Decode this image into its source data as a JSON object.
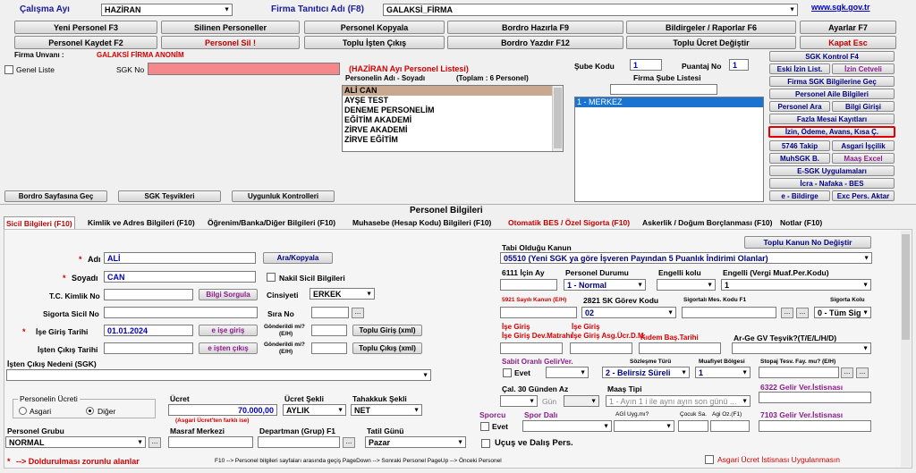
{
  "header": {
    "period_label": "Çalışma Ayı",
    "period_value": "HAZİRAN",
    "company_id_label": "Firma Tanıtıcı Adı (F8)",
    "company_id_value": "GALAKSİ_FİRMA",
    "sgk_link": "www.sgk.gov.tr"
  },
  "toolbar": {
    "yeni_personel": "Yeni Personel F3",
    "silinen_personeller": "Silinen Personeller",
    "personel_kopyala": "Personel Kopyala",
    "bordro_hazirla": "Bordro Hazırla F9",
    "bildirgeler": "Bildirgeler / Raporlar F6",
    "ayarlar": "Ayarlar F7",
    "personel_kaydet": "Personel Kaydet F2",
    "personel_sil": "Personel Sil !",
    "toplu_isten_cikis": "Toplu İşten Çıkış",
    "bordro_yazdir": "Bordro Yazdır F12",
    "toplu_ucret": "Toplu Ücret Değiştir",
    "kapat": "Kapat Esc"
  },
  "company": {
    "unvan_label": "Firma Unvanı :",
    "unvan_value": "GALAKSİ FİRMA ANONİM",
    "genel_liste": "Genel Liste",
    "sgk_no_label": "SGK No"
  },
  "personnel_list": {
    "title": "(HAZİRAN Ayı Personel Listesi)",
    "name_header": "Personelin Adı - Soyadı",
    "total": "(Toplam : 6 Personel)",
    "rows": [
      "ALİ CAN",
      "AYŞE TEST",
      "DENEME PERSONELİM",
      "EĞİTİM AKADEMİ",
      "ZİRVE AKADEMİ",
      "ZİRVE EĞİTİM"
    ]
  },
  "branch": {
    "sube_kodu_label": "Şube Kodu",
    "sube_kodu_value": "1",
    "puantaj_label": "Puantaj No",
    "puantaj_value": "1",
    "list_title": "Firma Şube Listesi",
    "items": [
      "1 - MERKEZ"
    ]
  },
  "side_buttons": {
    "sgk_kontrol": "SGK Kontrol F4",
    "eski_izin": "Eski İzin List.",
    "izin_cetveli": "İzin Cetveli",
    "firma_sgk": "Firma SGK Bilgilerine Geç",
    "aile": "Personel Aile Bilgileri",
    "personel_ara": "Personel Ara",
    "bilgi_girisi": "Bilgi Girişi",
    "fazla_mesai": "Fazla Mesai Kayıtları",
    "izin_odeme": "İzin, Ödeme, Avans, Kısa Ç.",
    "takip_5746": "5746 Takip",
    "asgari_iscilik": "Asgari İşçilik",
    "muhsgk": "MuhSGK B.",
    "maas_excel": "Maaş Excel",
    "esgk": "E-SGK Uygulamaları",
    "icra": "İcra - Nafaka - BES",
    "ebildirge": "e - Bildirge",
    "exc_pers": "Exc Pers. Aktar"
  },
  "lower_buttons": {
    "bordro_sayfasi": "Bordro Sayfasına Geç",
    "sgk_tesvikleri": "SGK Teşvikleri",
    "uygunluk": "Uygunluk Kontrolleri"
  },
  "section_title": "Personel Bilgileri",
  "tabs": [
    "Sicil Bilgileri (F10)",
    "Kimlik ve Adres Bilgileri (F10)",
    "Öğrenim/Banka/Diğer Bilgileri (F10)",
    "Muhasebe (Hesap Kodu) Bilgileri (F10)",
    "Otomatik BES / Özel Sigorta (F10)",
    "Askerlik / Doğum Borçlanması (F10)",
    "Notlar (F10)"
  ],
  "form": {
    "adi_label": "Adı",
    "adi_value": "ALİ",
    "ara_kopyala": "Ara/Kopyala",
    "soyadi_label": "Soyadı",
    "soyadi_value": "CAN",
    "nakil_sicil": "Nakil Sicil Bilgileri",
    "tc_label": "T.C. Kimlik No",
    "bilgi_sorgula": "Bilgi Sorgula",
    "cinsiyet_label": "Cinsiyeti",
    "cinsiyet_value": "ERKEK",
    "sigorta_sicil_label": "Sigorta Sicil No",
    "sira_no_label": "Sıra No",
    "ise_giris_label": "İşe Giriş Tarihi",
    "ise_giris_value": "01.01.2024",
    "e_ise_giris": "e işe giriş",
    "gonderildi_line1": "Gönderildi mi?",
    "gonderildi_line2": "(E/H)",
    "toplu_giris": "Toplu Giriş (xml)",
    "isten_cikis_label": "İşten Çıkış Tarihi",
    "e_isten_cikis": "e işten çıkış",
    "toplu_cikis": "Toplu Çıkış (xml)",
    "cikis_nedeni_label": "İşten Çıkış Nedeni (SGK)",
    "ucret_group": "Personelin Ücreti",
    "asgari": "Asgari",
    "diger": "Diğer",
    "ucret_label": "Ücret",
    "ucret_value": "70.000,00",
    "ucret_sekli_label": "Ücret Şekli",
    "ucret_sekli_value": "AYLIK",
    "tahakkuk_label": "Tahakkuk Şekli",
    "tahakkuk_value": "NET",
    "asgari_note": "(Asgari Ücret'ten farklı ise)",
    "personel_grubu_label": "Personel Grubu",
    "personel_grubu_value": "NORMAL",
    "masraf_label": "Masraf Merkezi",
    "departman_label": "Departman (Grup) F1",
    "tatil_label": "Tatil Günü",
    "tatil_value": "Pazar",
    "zorunlu_star": "*",
    "zorunlu_note": "--> Doldurulması zorunlu alanlar",
    "help_text": "F10 --> Personel bilgileri sayfaları arasında geçiş PageDown --> Sonraki Personel PageUp --> Önceki Personel"
  },
  "right_form": {
    "toplu_kanun": "Toplu Kanun No Değiştir",
    "tabi_kanun_label": "Tabi Olduğu Kanun",
    "tabi_kanun_value": "05510 (Yeni SGK ya göre İşveren Payından 5 Puanlık İndirimi Olanlar)",
    "icin_6111": "6111 İçin Ay",
    "personel_durumu": "Personel Durumu",
    "personel_durumu_value": "1 - Normal",
    "engelli_kolu": "Engelli kolu",
    "engelli_vergi": "Engelli (Vergi Muaf.Per.Kodu)",
    "engelli_vergi_value": "1",
    "kanun_5921": "5921 Sayılı Kanun (E/H)",
    "gorev_kodu": "2821 SK Görev Kodu",
    "gorev_kodu_value": "02",
    "sigortali_mes": "Sigortalı Mes. Kodu F1",
    "sigorta_kolu": "Sigorta Kolu",
    "sigorta_kolu_value": "0 - Tüm Sig",
    "ise_giris_dev": "İşe Giriş Dev.Matrahı",
    "ise_giris_asg": "İşe Giriş Asg.Ücr.D.M.",
    "kidem_bas": "Kıdem Baş.Tarihi",
    "ar_ge": "Ar-Ge GV Teşvik?(T/E/L/H/D)",
    "sabit_oranli": "Sabit Oranlı GelirVer.",
    "evet": "Evet",
    "sozlesme_turu": "Sözleşme Türü",
    "sozlesme_value": "2 - Belirsiz Süreli",
    "muafiyet_bolgesi": "Muafiyet Bölgesi",
    "muafiyet_value": "1",
    "stopaj_tesv": "Stopaj Tesv. Fay. mu? (E/H)",
    "cal_30": "Çal. 30 Günden Az",
    "maas_tipi": "Maaş Tipi",
    "maas_tipi_value": "1 - Ayın 1 i ile aynı ayın son günü ...",
    "gelir_6322": "6322 Gelir Ver.İstisnası",
    "gun": "Gün",
    "sporcu": "Sporcu",
    "spor_dali": "Spor Dalı",
    "agi_uyg": "AGİ Uyg.mı?",
    "cocuk_sa": "Çocuk Sa.",
    "agi_oz": "Agi Oz.(F1)",
    "gelir_7103": "7103 Gelir Ver.İstisnası",
    "ucus_dalis": "Uçuş ve Dalış Pers.",
    "asgari_istisna": "Asgari Ücret İstisnası Uygulanmasın"
  },
  "colors": {
    "accent_red": "#d40000",
    "link_blue": "#0000c0",
    "selected_row": "#c9a890",
    "branch_selected": "#1a73d0",
    "sgk_input_bg": "#f4888c",
    "highlight_border": "#e00000"
  }
}
